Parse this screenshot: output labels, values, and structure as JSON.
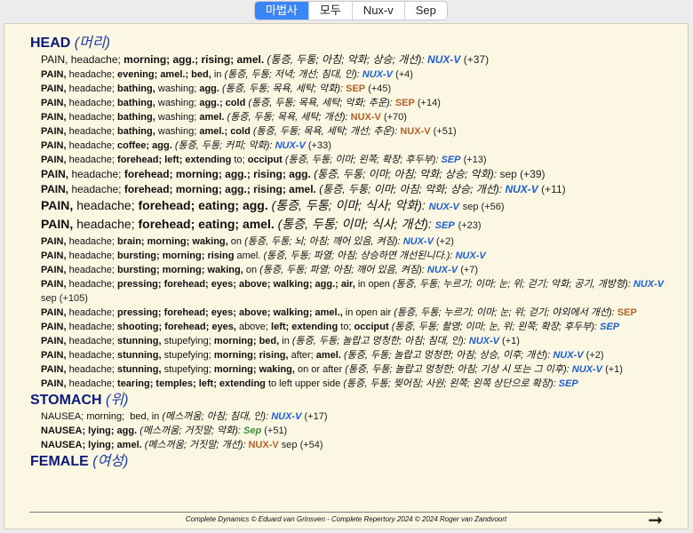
{
  "tabs": [
    {
      "label": "마법사",
      "active": true
    },
    {
      "label": "모두",
      "active": false
    },
    {
      "label": "Nux-v",
      "active": false
    },
    {
      "label": "Sep",
      "active": false
    }
  ],
  "chapters": [
    {
      "name": "HEAD",
      "tr": "(머리)",
      "rubrics": [
        {
          "size": "s12",
          "html": "PAIN, headache; <b>morning; agg.; rising; amel.</b> <span class=\"tr\">(통증, 두통; 아침; 악화; 상승; 개선):</span> <span class=\"rem\">NUX-V</span> <span class=\"extra\">(+37)</span>"
        },
        {
          "size": "",
          "html": "<b>PAIN,</b> headache; <b>evening; amel.; bed,</b> in <span class=\"tr\">(통증, 두통; 저녁; 개선; 침대, 인):</span> <span class=\"rem\">NUX-V</span> <span class=\"extra\">(+4)</span>"
        },
        {
          "size": "",
          "html": "<b>PAIN,</b> headache; <b>bathing,</b> washing; <b>agg.</b> <span class=\"tr\">(통증, 두통; 목욕, 세탁; 악화):</span> <span class=\"rem sep\">SEP</span> <span class=\"extra\">(+45)</span>"
        },
        {
          "size": "",
          "html": "<b>PAIN,</b> headache; <b>bathing,</b> washing; <b>agg.; cold</b> <span class=\"tr\">(통증, 두통; 목욕, 세탁; 악화; 추운):</span> <span class=\"rem sep\">SEP</span> <span class=\"extra\">(+14)</span>"
        },
        {
          "size": "",
          "html": "<b>PAIN,</b> headache; <b>bathing,</b> washing; <b>amel.</b> <span class=\"tr\">(통증, 두통; 목욕, 세탁; 개선):</span> <span class=\"rem sep\">NUX-V</span> <span class=\"extra\">(+70)</span>"
        },
        {
          "size": "",
          "html": "<b>PAIN,</b> headache; <b>bathing,</b> washing; <b>amel.; cold</b> <span class=\"tr\">(통증, 두통; 목욕, 세탁; 개선; 추운):</span> <span class=\"rem sep\">NUX-V</span> <span class=\"extra\">(+51)</span>"
        },
        {
          "size": "",
          "html": "<b>PAIN,</b> headache; <b>coffee; agg.</b> <span class=\"tr\">(통증, 두통; 커피; 악화):</span> <span class=\"rem\">NUX-V</span> <span class=\"extra\">(+33)</span>"
        },
        {
          "size": "",
          "html": "<b>PAIN,</b> headache; <b>forehead; left; extending</b> to; <b>occiput</b> <span class=\"tr\">(통증, 두통; 이마; 왼쪽; 확장; 후두부):</span> <span class=\"rem\">SEP</span> <span class=\"extra\">(+13)</span>"
        },
        {
          "size": "s12",
          "html": "<b>PAIN,</b> headache; <b>forehead; morning; agg.; rising; agg.</b> <span class=\"tr\">(통증, 두통; 이마; 아침; 악화; 상승; 악화):</span> <span class=\"rem plain\">sep</span> <span class=\"extra\">(+39)</span>"
        },
        {
          "size": "s12",
          "html": "<b>PAIN,</b> headache; <b>forehead; morning; agg.; rising; amel.</b> <span class=\"tr\">(통증, 두통; 이마; 아침; 악화; 상승; 개선):</span> <span class=\"rem\">NUX-V</span> <span class=\"extra\">(+11)</span>"
        },
        {
          "size": "s14",
          "html": "<b>PAIN,</b> headache; <b>forehead; eating; agg.</b> <span class=\"tr\">(통증, 두통; 이마; 식사; 악화):</span> <span class=\"rem\" style=\"font-size:11px\">NUX-V</span> <span class=\"extra\" style=\"font-size:11px\">sep (+56)</span>"
        },
        {
          "size": "s14",
          "html": "<b>PAIN,</b> headache; <b>forehead; eating; amel.</b> <span class=\"tr\">(통증, 두통; 이마; 식사; 개선):</span> <span class=\"rem\" style=\"font-size:11px\">SEP</span> <span class=\"extra\" style=\"font-size:11px\">(+23)</span>"
        },
        {
          "size": "",
          "html": "<b>PAIN,</b> headache; <b>brain; morning; waking,</b> on <span class=\"tr\">(통증, 두통; 뇌; 아침; 깨어 있음, 켜짐):</span> <span class=\"rem\">NUX-V</span> <span class=\"extra\">(+2)</span>"
        },
        {
          "size": "",
          "html": "<b>PAIN,</b> headache; <b>bursting; morning; rising</b> amel. <span class=\"tr\">(통증, 두통; 파열; 아침; 상승하면 개선된니다.):</span> <span class=\"rem\">NUX-V</span>"
        },
        {
          "size": "",
          "html": "<b>PAIN,</b> headache; <b>bursting; morning; waking,</b> on <span class=\"tr\">(통증, 두통; 파열; 아침; 깨어 있음, 켜짐):</span> <span class=\"rem\">NUX-V</span> <span class=\"extra\">(+7)</span>"
        },
        {
          "size": "wrap",
          "html": "<b>PAIN,</b> headache; <b>pressing; forehead; eyes; above; walking; agg.; air,</b> in open <span class=\"tr\">(통증, 두통; 누르기; 이마; 눈; 위; 걷기; 악화; 공기, 개방형):</span> <span class=\"rem\">NUX-V</span> <span class=\"extra\">sep (+105)</span>"
        },
        {
          "size": "wrap",
          "html": "<b>PAIN,</b> headache; <b>pressing; forehead; eyes; above; walking; amel.,</b> in open air <span class=\"tr\">(통증, 두통; 누르기; 이마; 눈; 위; 걷기; 야외에서 개선):</span> <span class=\"rem sep\">SEP</span>"
        },
        {
          "size": "",
          "html": "<b>PAIN,</b> headache; <b>shooting; forehead; eyes,</b> above; <b>left; extending</b> to; <b>occiput</b> <span class=\"tr\">(통증, 두통; 촬영; 이마; 눈, 위; 왼쪽; 확장; 후두부):</span> <span class=\"rem\">SEP</span>"
        },
        {
          "size": "",
          "html": "<b>PAIN,</b> headache; <b>stunning,</b> stupefying; <b>morning; bed,</b> in <span class=\"tr\">(통증, 두통; 놀랍고 멍청한; 아침; 침대, 인):</span> <span class=\"rem\">NUX-V</span> <span class=\"extra\">(+1)</span>"
        },
        {
          "size": "",
          "html": "<b>PAIN,</b> headache; <b>stunning,</b> stupefying; <b>morning; rising,</b> after; <b>amel.</b> <span class=\"tr\">(통증, 두통; 놀랍고 멍청한; 아침; 상승, 이후; 개선):</span> <span class=\"rem\">NUX-V</span> <span class=\"extra\">(+2)</span>"
        },
        {
          "size": "",
          "html": "<b>PAIN,</b> headache; <b>stunning,</b> stupefying; <b>morning; waking,</b> on or after <span class=\"tr\">(통증, 두통; 놀랍고 멍청한; 아침; 기상 시 또는 그 이후):</span> <span class=\"rem\">NUX-V</span> <span class=\"extra\">(+1)</span>"
        },
        {
          "size": "",
          "html": "<b>PAIN,</b> headache; <b>tearing; temples; left; extending</b> to left upper side <span class=\"tr\">(통증, 두통; 찢어짐; 사원; 왼쪽; 왼쪽 상단으로 확장):</span> <span class=\"rem\">SEP</span>"
        }
      ]
    },
    {
      "name": "STOMACH",
      "tr": "(위)",
      "rubrics": [
        {
          "size": "",
          "html": "NAUSEA; morning; &nbsp;bed, in <span class=\"tr\">(메스꺼움; 아침; 침대, 인):</span> <span class=\"rem\">NUX-V</span> <span class=\"extra\">(+17)</span>"
        },
        {
          "size": "",
          "html": "<b>NAUSEA; lying; agg.</b> <span class=\"tr\">(메스꺼움; 거짓말; 악화):</span> <span class=\"rem sep2\">Sep</span> <span class=\"extra\">(+51)</span>"
        },
        {
          "size": "",
          "html": "<b>NAUSEA; lying; amel.</b> <span class=\"tr\">(메스꺼움; 거짓말; 개선):</span> <span class=\"rem sep\">NUX-V</span> <span class=\"extra\">sep (+54)</span>"
        }
      ]
    },
    {
      "name": "FEMALE",
      "tr": "(여성)",
      "rubrics": []
    }
  ],
  "footer": "Complete Dynamics © Eduard van Grinsven  -  Complete Repertory 2024 © 2024 Roger van Zandvoort",
  "next_icon": "arrow-right-icon"
}
